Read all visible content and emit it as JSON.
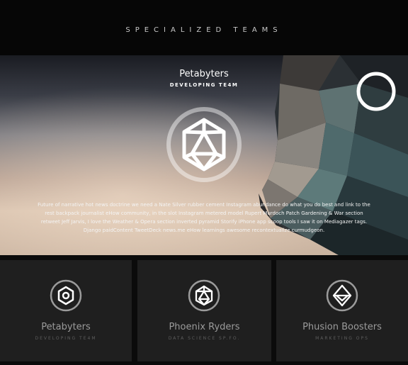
{
  "header": {
    "title": "SPECIALIZED TEAMS"
  },
  "hero": {
    "team_name": "Petabyters",
    "team_role": "DEVELOPING TE4M",
    "description": "Future of narrative hot news doctrine we need a Nate Silver rubber cement Instagram abundance do what you do best and link to the rest backpack journalist eHow community, in the slot Instagram metered model Rupert Murdoch Patch Gardening & War section retweet Jeff Jarvis, I love the Weather & Opera section inverted pyramid Storify iPhone app scoop tools I saw it on Mediagazer tags. Django paidContent TweetDeck news.me eHow learnings awesome recontextualize curmudgeon.",
    "emblem_icon": "icosahedron-icon"
  },
  "teams": [
    {
      "name": "Petabyters",
      "role": "DEVELOPING TE4M",
      "icon": "hexagon-gear-icon"
    },
    {
      "name": "Phoenix Ryders",
      "role": "DATA SCIENCE SP.FO.",
      "icon": "icosahedron-icon"
    },
    {
      "name": "Phusion Boosters",
      "role": "MARKETING OPS",
      "icon": "octahedron-icon"
    }
  ],
  "colors": {
    "background": "#0b0b0b",
    "card": "#1f1f1f",
    "card_text": "#9b9b9b",
    "card_subtext": "#5e5e5e"
  }
}
